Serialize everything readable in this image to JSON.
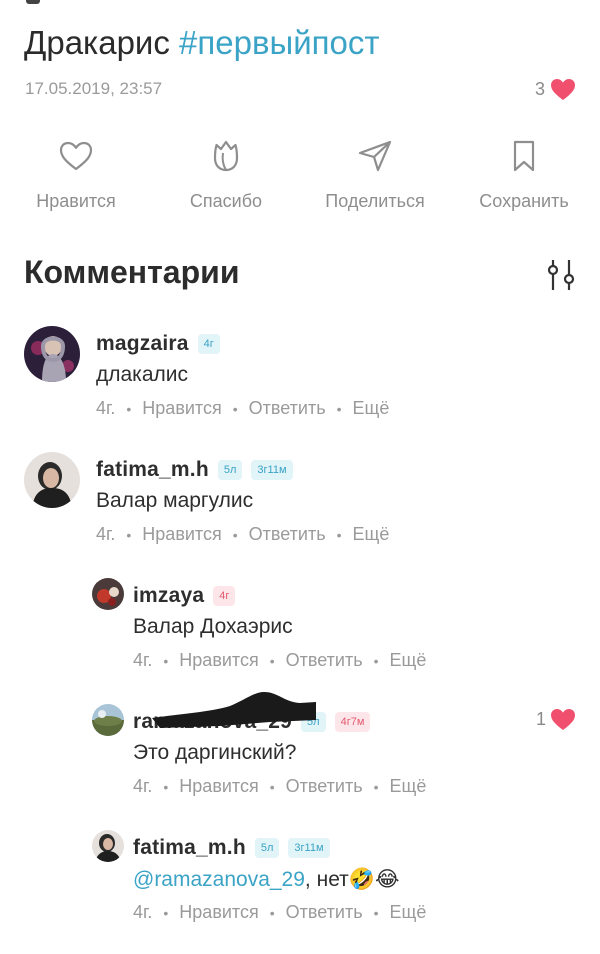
{
  "post": {
    "title": "Дракарис ",
    "hashtag": "#первыйпост",
    "date": "17.05.2019, 23:57",
    "likes": "3"
  },
  "actions": [
    {
      "label": "Нравится",
      "icon": "heart-outline-icon"
    },
    {
      "label": "Спасибо",
      "icon": "tulip-icon"
    },
    {
      "label": "Поделиться",
      "icon": "send-icon"
    },
    {
      "label": "Сохранить",
      "icon": "bookmark-icon"
    }
  ],
  "comments_section": {
    "title": "Комментарии",
    "filter_icon": "sliders-icon"
  },
  "meta_labels": {
    "like": "Нравится",
    "reply": "Ответить",
    "more": "Ещё",
    "dot": "•"
  },
  "comments": [
    {
      "username": "magzaira",
      "badges": [
        "4г"
      ],
      "text": "длакалис",
      "time": "4г."
    },
    {
      "username": "fatima_m.h",
      "badges": [
        "5л",
        "3г11м"
      ],
      "text": "Валар маргулис",
      "time": "4г."
    },
    {
      "username": "imzaya",
      "badges": [
        "4г"
      ],
      "text": "Валар Дохаэрис",
      "time": "4г."
    },
    {
      "username": "ramazanova_29",
      "badges": [
        "5л",
        "4г7м"
      ],
      "text": "Это даргинский?",
      "time": "4г.",
      "likes": "1"
    },
    {
      "username": "fatima_m.h",
      "badges": [
        "5л",
        "3г11м"
      ],
      "mention": "@ramazanova_29",
      "text": ", нет",
      "emoji": "🤣😂",
      "time": "4г."
    }
  ],
  "colors": {
    "accent": "#3aa3c6",
    "heart": "#f0506e",
    "muted": "#9a9a9a",
    "text": "#2e2e2e"
  }
}
